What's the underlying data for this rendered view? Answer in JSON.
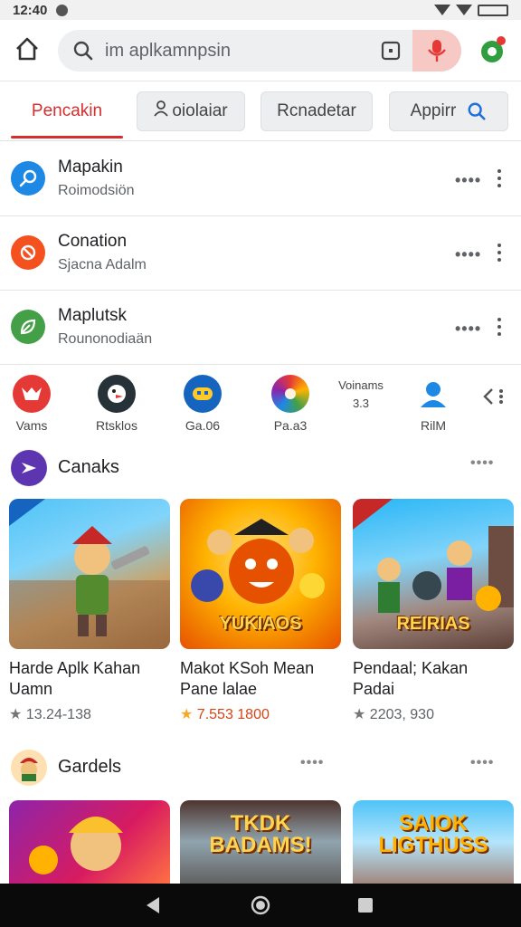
{
  "status": {
    "time": "12:40"
  },
  "search": {
    "placeholder": "im aplkamnpsin"
  },
  "tabs": [
    {
      "label": "Pencakin",
      "active": true
    },
    {
      "label": "oiolaiar",
      "icon": "person-icon"
    },
    {
      "label": "Rcnadetar"
    },
    {
      "label": "Appirr",
      "icon": "search-icon"
    }
  ],
  "list": [
    {
      "title": "Mapakin",
      "subtitle": "Roimodsiön",
      "icon": "compass-icon",
      "color": "#1e88e5"
    },
    {
      "title": "Conation",
      "subtitle": "Sjacna Adalm",
      "icon": "flame-icon",
      "color": "#f4511e"
    },
    {
      "title": "Maplutsk",
      "subtitle": "Rounonodiaän",
      "icon": "leaf-icon",
      "color": "#43a047"
    }
  ],
  "shortcuts": [
    {
      "label": "Vams",
      "icon": "mask-icon",
      "color": "#e53935"
    },
    {
      "label": "Rtsklos",
      "icon": "penguin-icon",
      "color": "#263238"
    },
    {
      "label": "Ga.06",
      "icon": "controller-icon",
      "color": "#1565c0"
    },
    {
      "label": "Pa.a3",
      "icon": "palette-icon",
      "color": "#ff7043"
    },
    {
      "label_top": "Voinams",
      "label_mid": "3.3",
      "icon": "text-icon"
    },
    {
      "label": "RilM",
      "icon": "user-icon",
      "color": "#1e88e5"
    }
  ],
  "sections": [
    {
      "title": "Canaks",
      "icon": "star-burst-icon",
      "color": "#5e35b1",
      "cards": [
        {
          "name_line1": "Harde Aplk Kahan",
          "name_line2": "Uamn",
          "rating": "13.24-138",
          "art": "warrior-game-art"
        },
        {
          "name_line1": "Makot KSoh Mean",
          "name_line2": "Pane lalae",
          "rating": "7.553 1800",
          "art": "fox-game-art",
          "art_text": "YUKIAOS",
          "highlight": true
        },
        {
          "name_line1": "Pendaal; Kakan",
          "name_line2": "Padai",
          "rating": "2203, 930",
          "art": "party-game-art",
          "art_text": "REIRIAS"
        }
      ]
    },
    {
      "title": "Gardels",
      "icon": "gamer-avatar-icon",
      "cards": [
        {
          "art": "hero-game-art"
        },
        {
          "art": "road-game-art",
          "art_text": "TKDK BADAMS!"
        },
        {
          "art": "village-game-art",
          "art_text": "SAIOK LIGTHUSS"
        }
      ]
    }
  ],
  "colors": {
    "accent": "#d32f2f",
    "mic_bg": "#f6c9c5",
    "chip_bg": "#eceef0"
  }
}
